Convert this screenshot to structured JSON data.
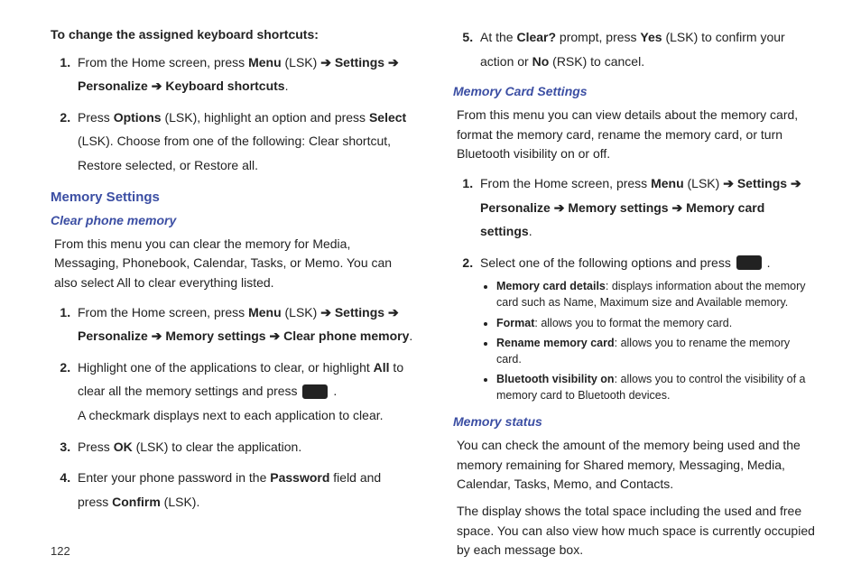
{
  "pageNumber": "122",
  "left": {
    "intro": "To change the assigned keyboard shortcuts:",
    "list1": {
      "i1": {
        "pre": "From the Home screen, press ",
        "menu": "Menu",
        "lsk": " (LSK) ",
        "arrow": "➔ ",
        "settings": "Settings",
        "arrow2": " ➔ ",
        "personalize": "Personalize",
        "arrow3": " ➔ ",
        "kbd": "Keyboard shortcuts",
        "period": "."
      },
      "i2": {
        "a": "Press ",
        "opt": "Options",
        "b": " (LSK), highlight an option and press ",
        "sel": "Select",
        "c": " (LSK). Choose from one of the following: Clear shortcut, Restore selected, or Restore all."
      }
    },
    "hSection": "Memory Settings",
    "hSub": "Clear phone memory",
    "para1": "From this menu you can clear the memory for Media, Messaging, Phonebook, Calendar, Tasks, or Memo. You can also select All to clear everything listed.",
    "list2": {
      "i1": {
        "a": "From the Home screen, press ",
        "menu": "Menu",
        "lsk": " (LSK) ",
        "ar1": "➔ ",
        "settings": "Settings",
        "ar2": " ➔ ",
        "pers": "Personalize",
        "ar3": " ➔ ",
        "mem": "Memory settings",
        "ar4": " ➔ ",
        "clr": "Clear phone memory",
        "p": "."
      },
      "i2": {
        "a": "Highlight one of the applications to clear, or highlight ",
        "all": "All",
        "b": " to clear all the memory settings and press  ",
        "c": " .",
        "d": "A checkmark displays next to each application to clear."
      },
      "i3": {
        "a": "Press ",
        "ok": "OK",
        "b": " (LSK) to clear the application."
      },
      "i4": {
        "a": "Enter your phone password in the ",
        "pw": "Password",
        "b": " field and press ",
        "cf": "Confirm",
        "c": " (LSK)."
      }
    }
  },
  "right": {
    "list1": {
      "start": "5",
      "i5": {
        "a": "At the ",
        "clr": "Clear?",
        "b": " prompt, press ",
        "yes": "Yes",
        "c": " (LSK) to confirm your action or ",
        "no": "No",
        "d": " (RSK) to cancel."
      }
    },
    "hSub1": "Memory Card Settings",
    "para1": "From this menu you can view details about the memory card, format the memory card, rename the memory card, or turn Bluetooth visibility on or off.",
    "list2": {
      "i1": {
        "a": "From the Home screen, press ",
        "menu": "Menu",
        "lsk": " (LSK) ",
        "ar1": "➔ ",
        "settings": "Settings",
        "ar2": " ➔ ",
        "pers": "Personalize",
        "ar3": " ➔ ",
        "mem": "Memory settings",
        "ar4": " ➔ ",
        "mc": "Memory card settings",
        "p": "."
      },
      "i2": {
        "a": "Select one of the following options and press  ",
        "b": " ."
      }
    },
    "bullets": {
      "b1a": "Memory card details",
      "b1b": ": displays information about the memory card such as Name, Maximum size and Available memory.",
      "b2a": "Format",
      "b2b": ": allows you to format the memory card.",
      "b3a": "Rename memory card",
      "b3b": ": allows you to rename the memory card.",
      "b4a": "Bluetooth visibility on",
      "b4b": ": allows you to control the visibility of a memory card to Bluetooth devices."
    },
    "hSub2": "Memory status",
    "para2": "You can check the amount of the memory being used and the memory remaining for Shared memory, Messaging, Media, Calendar, Tasks, Memo, and Contacts.",
    "para3": "The display shows the total space including the used and free space. You can also view how much space is currently occupied by each message box."
  }
}
